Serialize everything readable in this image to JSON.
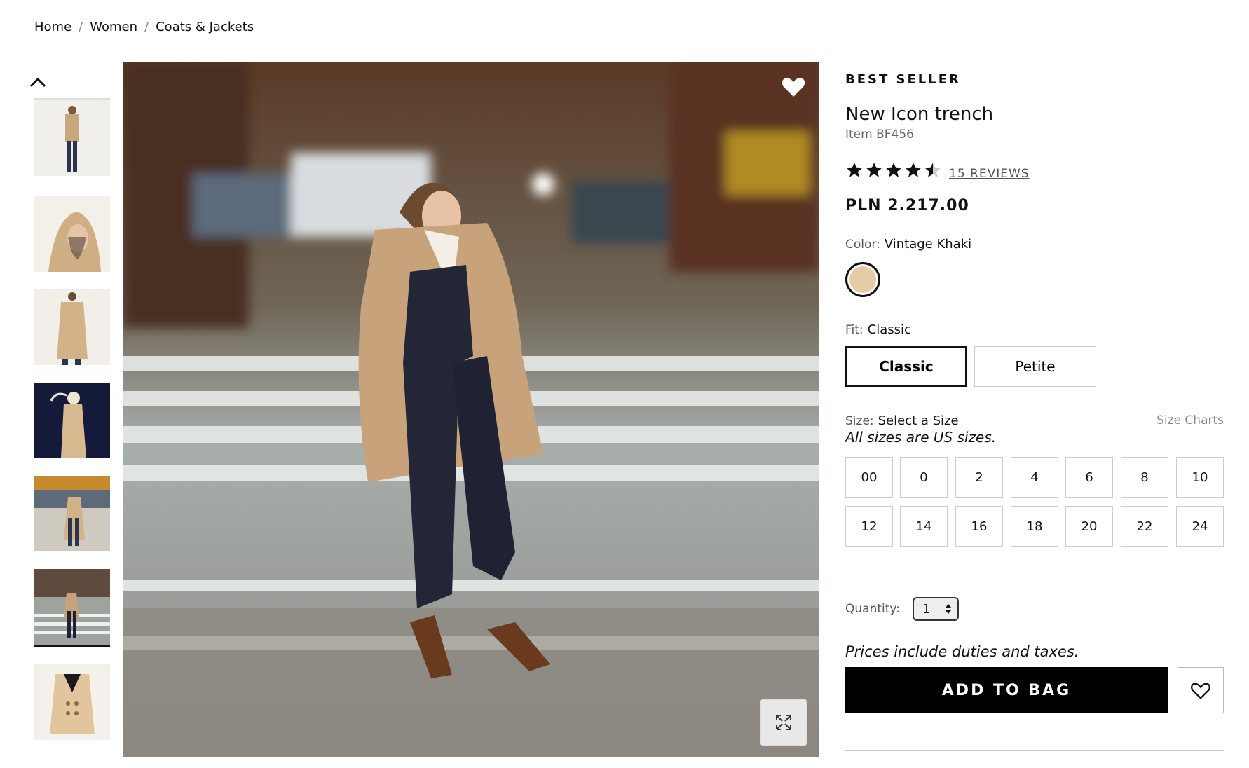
{
  "breadcrumb": {
    "home": "Home",
    "sep": "/",
    "women": "Women",
    "category": "Coats & Jackets"
  },
  "gallery": {
    "thumbnails": [
      "Model front full length",
      "Hood up portrait",
      "Side back view",
      "Dark background pose",
      "Street walking",
      "Crosswalk pose",
      "Flat lay coat"
    ],
    "selected_index": 5,
    "up_icon": "chevron-up-icon",
    "favorite_icon": "heart-icon",
    "expand_icon": "expand-icon"
  },
  "product": {
    "badge": "BEST SELLER",
    "title": "New Icon trench",
    "item_number": "Item BF456",
    "rating": 4.5,
    "reviews": "15 REVIEWS",
    "price": "PLN 2.217.00",
    "color_label": "Color:",
    "color_value": "Vintage Khaki",
    "swatch_color": "#e4cca4",
    "fit_label": "Fit:",
    "fit_value": "Classic",
    "fit_options": [
      "Classic",
      "Petite"
    ],
    "size_label": "Size:",
    "size_value": "Select a Size",
    "size_charts": "Size Charts",
    "size_note": "All sizes are US sizes.",
    "sizes": [
      "00",
      "0",
      "2",
      "4",
      "6",
      "8",
      "10",
      "12",
      "14",
      "16",
      "18",
      "20",
      "22",
      "24"
    ],
    "quantity_label": "Quantity:",
    "quantity_value": "1",
    "duties_note": "Prices include duties and taxes.",
    "add_to_bag": "ADD TO BAG",
    "wishlist_icon": "heart-outline-icon"
  },
  "colors": {
    "accent": "#000000",
    "text": "#111111",
    "muted": "#666666",
    "border": "#cccccc"
  }
}
